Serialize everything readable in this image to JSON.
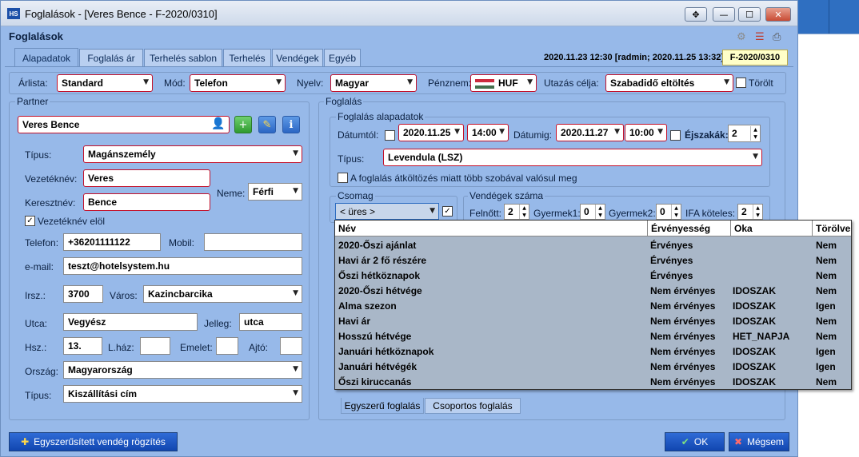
{
  "window": {
    "title": "Foglalások - [Veres Bence - F-2020/0310]",
    "heading": "Foglalások",
    "app_badge": "HS",
    "controls": {
      "move": "✥",
      "minimize": "—",
      "maximize": "☐",
      "close": "✕"
    }
  },
  "tabs": [
    "Alapadatok",
    "Foglalás ár",
    "Terhelés sablon",
    "Terhelés",
    "Vendégek",
    "Egyéb"
  ],
  "header_info": {
    "timestamp": "2020.11.23 12:30 [radmin; 2020.11.25 13:32]",
    "booking_code": "F-2020/0310"
  },
  "topbar": {
    "arlista_label": "Árlista:",
    "arlista_value": "Standard",
    "mod_label": "Mód:",
    "mod_value": "Telefon",
    "nyelv_label": "Nyelv:",
    "nyelv_value": "Magyar",
    "penznem_label": "Pénznem:",
    "penznem_value": "HUF",
    "utazas_label": "Utazás célja:",
    "utazas_value": "Szabadidő eltöltés",
    "torolt_label": "Törölt"
  },
  "partner": {
    "group_title": "Partner",
    "name": "Veres Bence",
    "tipus_label": "Típus:",
    "tipus_value": "Magánszemély",
    "vezeteknev_label": "Vezetéknév:",
    "vezeteknev_value": "Veres",
    "keresztnev_label": "Keresztnév:",
    "keresztnev_value": "Bence",
    "neme_label": "Neme:",
    "neme_value": "Férfi",
    "vezeteknev_elol_label": "Vezetéknév elöl",
    "telefon_label": "Telefon:",
    "telefon_value": "+36201111122",
    "mobil_label": "Mobil:",
    "mobil_value": "",
    "email_label": "e-mail:",
    "email_value": "teszt@hotelsystem.hu",
    "irsz_label": "Irsz.:",
    "irsz_value": "3700",
    "varos_label": "Város:",
    "varos_value": "Kazincbarcika",
    "utca_label": "Utca:",
    "utca_value": "Vegyész",
    "jelleg_label": "Jelleg:",
    "jelleg_value": "utca",
    "hsz_label": "Hsz.:",
    "hsz_value": "13.",
    "lhaz_label": "L.ház:",
    "emelet_label": "Emelet:",
    "ajto_label": "Ajtó:",
    "orszag_label": "Ország:",
    "orszag_value": "Magyarország",
    "tipus2_label": "Típus:",
    "tipus2_value": "Kiszállítási cím"
  },
  "foglalas": {
    "group_title": "Foglalás",
    "alap_title": "Foglalás alapadatok",
    "datumtol_label": "Dátumtól:",
    "datumtol_value": "2020.11.25",
    "datumtol_time": "14:00",
    "datumig_label": "Dátumig:",
    "datumig_value": "2020.11.27",
    "datumig_time": "10:00",
    "ejszakak_label": "Éjszakák:",
    "ejszakak_value": "2",
    "tipus_label": "Típus:",
    "tipus_value": "Levendula (LSZ)",
    "atkoltozes_label": "A foglalás átköltözés miatt több szobával valósul meg",
    "csomag_title": "Csomag",
    "csomag_value": "< üres >",
    "vendegek_title": "Vendégek száma",
    "felnott_label": "Felnőtt:",
    "felnott_value": "2",
    "gyermek1_label": "Gyermek1:",
    "gyermek1_value": "0",
    "gyermek2_label": "Gyermek2:",
    "gyermek2_value": "0",
    "ifa_label": "IFA köteles:",
    "ifa_value": "2"
  },
  "popup": {
    "headers": [
      "Név",
      "Érvényesség",
      "Oka",
      "Törölve"
    ],
    "rows": [
      {
        "nev": "2020-Őszi ajánlat",
        "erv": "Érvényes",
        "oka": "",
        "torolve": "Nem"
      },
      {
        "nev": "Havi ár 2 fő részére",
        "erv": "Érvényes",
        "oka": "",
        "torolve": "Nem"
      },
      {
        "nev": "Őszi hétköznapok",
        "erv": "Érvényes",
        "oka": "",
        "torolve": "Nem"
      },
      {
        "nev": "2020-Őszi hétvége",
        "erv": "Nem érvényes",
        "oka": "IDOSZAK",
        "torolve": "Nem"
      },
      {
        "nev": "Alma szezon",
        "erv": "Nem érvényes",
        "oka": "IDOSZAK",
        "torolve": "Igen"
      },
      {
        "nev": "Havi ár",
        "erv": "Nem érvényes",
        "oka": "IDOSZAK",
        "torolve": "Nem"
      },
      {
        "nev": "Hosszú hétvége",
        "erv": "Nem érvényes",
        "oka": "HET_NAPJA",
        "torolve": "Nem"
      },
      {
        "nev": "Januári hétköznapok",
        "erv": "Nem érvényes",
        "oka": "IDOSZAK",
        "torolve": "Igen"
      },
      {
        "nev": "Januári hétvégék",
        "erv": "Nem érvényes",
        "oka": "IDOSZAK",
        "torolve": "Igen"
      },
      {
        "nev": "Őszi kiruccanás",
        "erv": "Nem érvényes",
        "oka": "IDOSZAK",
        "torolve": "Nem"
      }
    ]
  },
  "bottom_tabs": [
    "Egyszerű foglalás",
    "Csoportos foglalás"
  ],
  "buttons": {
    "quick_guest": "Egyszerűsített vendég rögzítés",
    "ok": "OK",
    "cancel": "Mégsem"
  }
}
